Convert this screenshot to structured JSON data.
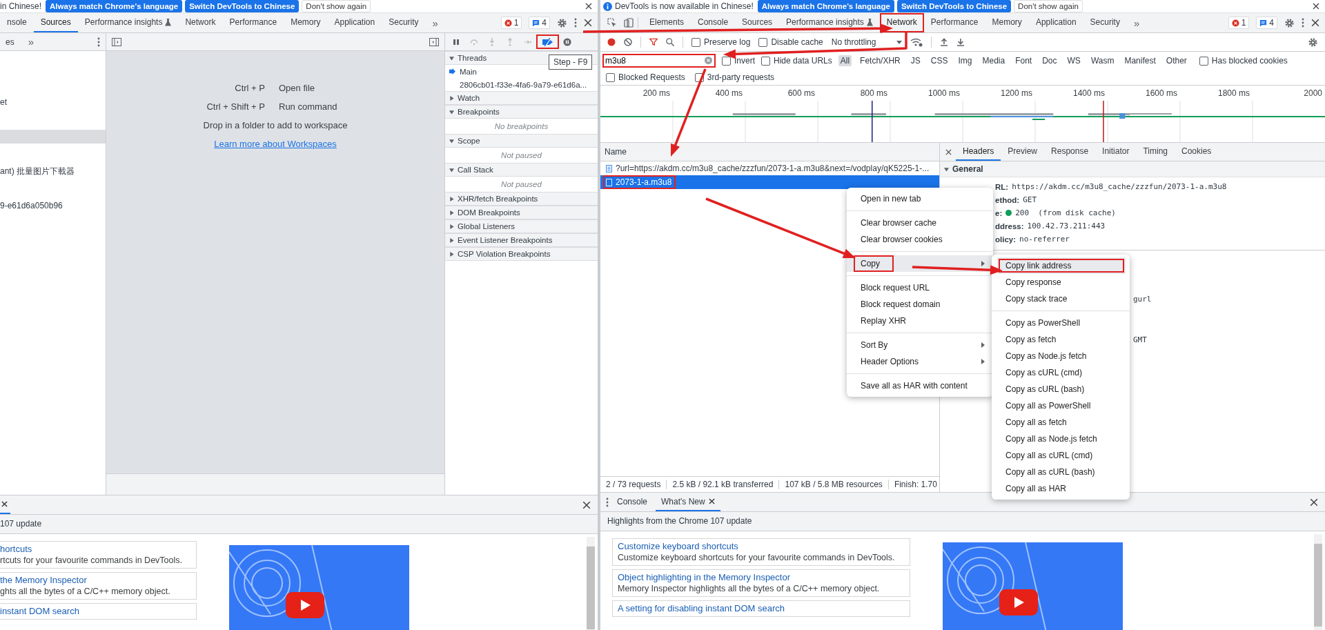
{
  "left": {
    "info_bar": {
      "message": "in Chinese!",
      "buttons": [
        {
          "label": "Always match Chrome's language",
          "kind": "primary"
        },
        {
          "label": "Switch DevTools to Chinese",
          "kind": "primary"
        },
        {
          "label": "Don't show again",
          "kind": "plain"
        }
      ]
    },
    "tabs": [
      {
        "label": "nsole",
        "selected": false
      },
      {
        "label": "Sources",
        "selected": true
      },
      {
        "label": "Performance insights",
        "selected": false,
        "experimental": true
      },
      {
        "label": "Network",
        "selected": false
      },
      {
        "label": "Performance",
        "selected": false
      },
      {
        "label": "Memory",
        "selected": false
      },
      {
        "label": "Application",
        "selected": false
      },
      {
        "label": "Security",
        "selected": false
      }
    ],
    "more_tabs": "»",
    "issues": {
      "errors": "1",
      "messages": "4"
    },
    "navigator": {
      "tab": "es",
      "more": "»",
      "items": [
        {
          "label": "et",
          "selected": false
        },
        {
          "selected": true
        },
        {
          "label": "ant) 批量图片下載器",
          "selected": false
        },
        {
          "label": "9-e61d6a050b96",
          "selected": false
        }
      ]
    },
    "editor": {
      "shortcuts": [
        {
          "keys": "Ctrl + P",
          "action": "Open file"
        },
        {
          "keys": "Ctrl + Shift + P",
          "action": "Run command"
        }
      ],
      "hint": "Drop in a folder to add to workspace",
      "link": "Learn more about Workspaces"
    },
    "debugger": {
      "deactivate_annotated": true,
      "tooltip": "Step - F9",
      "sections": [
        {
          "title": "Threads",
          "expanded": true,
          "items": [
            {
              "label": "Main",
              "selected": true
            },
            {
              "label": "2806cb01-f33e-4fa6-9a79-e61d6a...",
              "selected": false
            }
          ]
        },
        {
          "title": "Watch",
          "expanded": false
        },
        {
          "title": "Breakpoints",
          "expanded": true,
          "empty_text": "No breakpoints"
        },
        {
          "title": "Scope",
          "expanded": true,
          "empty_text": "Not paused"
        },
        {
          "title": "Call Stack",
          "expanded": true,
          "empty_text": "Not paused"
        },
        {
          "title": "XHR/fetch Breakpoints",
          "expanded": false
        },
        {
          "title": "DOM Breakpoints",
          "expanded": false
        },
        {
          "title": "Global Listeners",
          "expanded": false
        },
        {
          "title": "Event Listener Breakpoints",
          "expanded": false
        },
        {
          "title": "CSP Violation Breakpoints",
          "expanded": false
        }
      ]
    },
    "drawer": {
      "header": "107 update",
      "cards": [
        {
          "title": "hortcuts",
          "desc": "rtcuts for your favourite commands in DevTools."
        },
        {
          "title": "the Memory Inspector",
          "desc": "ghts all the bytes of a C/C++ memory object."
        },
        {
          "title": "instant DOM search"
        }
      ]
    }
  },
  "right": {
    "info_bar": {
      "message": "DevTools is now available in Chinese!",
      "buttons": [
        {
          "label": "Always match Chrome's language",
          "kind": "primary"
        },
        {
          "label": "Switch DevTools to Chinese",
          "kind": "primary"
        },
        {
          "label": "Don't show again",
          "kind": "plain"
        }
      ]
    },
    "tabs": [
      {
        "label": "Elements",
        "selected": false
      },
      {
        "label": "Console",
        "selected": false
      },
      {
        "label": "Sources",
        "selected": false
      },
      {
        "label": "Performance insights",
        "selected": false,
        "experimental": true
      },
      {
        "label": "Network",
        "selected": true,
        "annotated": true
      },
      {
        "label": "Performance",
        "selected": false
      },
      {
        "label": "Memory",
        "selected": false
      },
      {
        "label": "Application",
        "selected": false
      },
      {
        "label": "Security",
        "selected": false
      }
    ],
    "more_tabs": "»",
    "issues": {
      "errors": "1",
      "messages": "4"
    },
    "toolbar": {
      "checkboxes": [
        {
          "label": "Preserve log",
          "checked": false
        },
        {
          "label": "Disable cache",
          "checked": false
        }
      ],
      "throttling": "No throttling"
    },
    "filter": {
      "value": "m3u8",
      "annotated": true,
      "options": [
        {
          "label": "Invert",
          "checked": false
        },
        {
          "label": "Hide data URLs",
          "checked": false
        }
      ],
      "types": [
        {
          "label": "All",
          "selected": true
        },
        {
          "label": "Fetch/XHR",
          "selected": false
        },
        {
          "label": "JS",
          "selected": false
        },
        {
          "label": "CSS",
          "selected": false
        },
        {
          "label": "Img",
          "selected": false
        },
        {
          "label": "Media",
          "selected": false
        },
        {
          "label": "Font",
          "selected": false
        },
        {
          "label": "Doc",
          "selected": false
        },
        {
          "label": "WS",
          "selected": false
        },
        {
          "label": "Wasm",
          "selected": false
        },
        {
          "label": "Manifest",
          "selected": false
        },
        {
          "label": "Other",
          "selected": false
        }
      ],
      "blocked_cookies": {
        "label": "Has blocked cookies",
        "checked": false
      },
      "more_options": [
        {
          "label": "Blocked Requests",
          "checked": false
        },
        {
          "label": "3rd-party requests",
          "checked": false
        }
      ]
    },
    "timeline_ticks": [
      "200 ms",
      "400 ms",
      "600 ms",
      "800 ms",
      "1000 ms",
      "1200 ms",
      "1400 ms",
      "1600 ms",
      "1800 ms",
      "2000"
    ],
    "requests": {
      "column": "Name",
      "rows": [
        {
          "name": "?url=https://akdm.cc/m3u8_cache/zzzfun/2073-1-a.m3u8&next=/vodplay/qK5225-1-...",
          "kind": "document",
          "selected": false,
          "annotated": false
        },
        {
          "name": "2073-1-a.m3u8",
          "kind": "file",
          "selected": true,
          "annotated": true
        }
      ]
    },
    "status_bar": [
      "2 / 73 requests",
      "2.5 kB / 92.1 kB transferred",
      "107 kB / 5.8 MB resources",
      "Finish: 1.70"
    ],
    "details": {
      "tabs": [
        {
          "label": "Headers",
          "selected": true
        },
        {
          "label": "Preview",
          "selected": false
        },
        {
          "label": "Response",
          "selected": false
        },
        {
          "label": "Initiator",
          "selected": false
        },
        {
          "label": "Timing",
          "selected": false
        },
        {
          "label": "Cookies",
          "selected": false
        }
      ],
      "section": "General",
      "rows": [
        {
          "key": "RL:",
          "value": "https://akdm.cc/m3u8_cache/zzzfun/2073-1-a.m3u8"
        },
        {
          "key": "ethod:",
          "value": "GET"
        },
        {
          "key": "e:",
          "value": "200  (from disk cache)",
          "status_dot": true
        },
        {
          "key": "ddress:",
          "value": "100.42.73.211:443"
        },
        {
          "key": "olicy:",
          "value": "no-referrer"
        }
      ],
      "fragments": [
        "gurl",
        "GMT"
      ]
    },
    "context_menu": [
      [
        {
          "label": "Open in new tab",
          "highlighted": false
        }
      ],
      [
        {
          "label": "Clear browser cache",
          "highlighted": false
        },
        {
          "label": "Clear browser cookies",
          "highlighted": false
        }
      ],
      [
        {
          "label": "Copy",
          "highlighted": true,
          "submenu": true,
          "annotated": true
        }
      ],
      [
        {
          "label": "Block request URL",
          "highlighted": false
        },
        {
          "label": "Block request domain",
          "highlighted": false
        },
        {
          "label": "Replay XHR",
          "highlighted": false
        }
      ],
      [
        {
          "label": "Sort By",
          "highlighted": false,
          "submenu": true
        },
        {
          "label": "Header Options",
          "highlighted": false,
          "submenu": true
        }
      ],
      [
        {
          "label": "Save all as HAR with content",
          "highlighted": false
        }
      ]
    ],
    "copy_submenu": [
      [
        {
          "label": "Copy link address",
          "highlighted": true,
          "annotated": true
        },
        {
          "label": "Copy response",
          "highlighted": false
        },
        {
          "label": "Copy stack trace",
          "highlighted": false
        }
      ],
      [
        {
          "label": "Copy as PowerShell",
          "highlighted": false
        },
        {
          "label": "Copy as fetch",
          "highlighted": false
        },
        {
          "label": "Copy as Node.js fetch",
          "highlighted": false
        },
        {
          "label": "Copy as cURL (cmd)",
          "highlighted": false
        },
        {
          "label": "Copy as cURL (bash)",
          "highlighted": false
        },
        {
          "label": "Copy all as PowerShell",
          "highlighted": false
        },
        {
          "label": "Copy all as fetch",
          "highlighted": false
        },
        {
          "label": "Copy all as Node.js fetch",
          "highlighted": false
        },
        {
          "label": "Copy all as cURL (cmd)",
          "highlighted": false
        },
        {
          "label": "Copy all as cURL (bash)",
          "highlighted": false
        },
        {
          "label": "Copy all as HAR",
          "highlighted": false
        }
      ]
    ],
    "drawer": {
      "tabs": [
        {
          "label": "Console",
          "selected": false
        },
        {
          "label": "What's New",
          "selected": true,
          "closable": true
        }
      ],
      "header": "Highlights from the Chrome 107 update",
      "cards": [
        {
          "title": "Customize keyboard shortcuts",
          "desc": "Customize keyboard shortcuts for your favourite commands in DevTools."
        },
        {
          "title": "Object highlighting in the Memory Inspector",
          "desc": "Memory Inspector highlights all the bytes of a C/C++ memory object."
        },
        {
          "title": "A setting for disabling instant DOM search"
        }
      ]
    }
  }
}
